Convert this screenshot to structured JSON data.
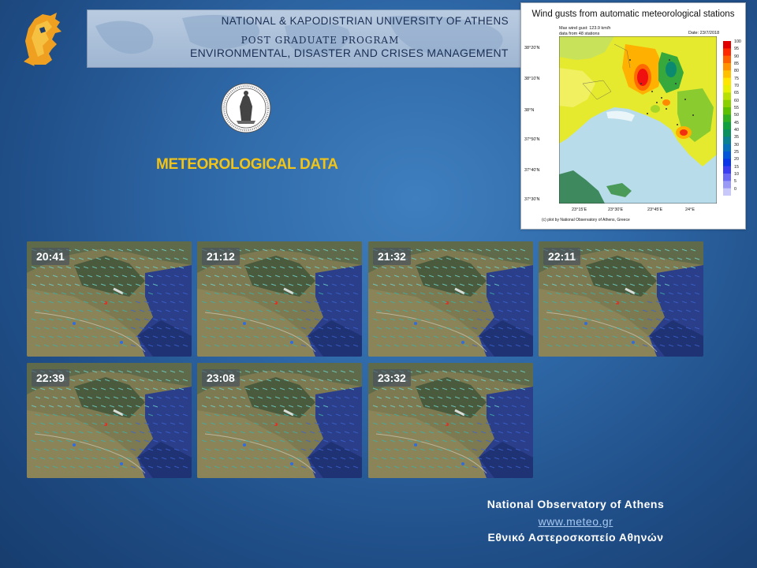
{
  "header": {
    "university": "NATIONAL & KAPODISTRIAN UNIVERSITY OF ATHENS",
    "program": "POST GRADUATE PROGRAM",
    "specialization": "ENVIRONMENTAL, DISASTER AND CRISES MANAGEMENT"
  },
  "section_title": "METEOROLOGICAL DATA",
  "map": {
    "title": "Wind gusts from automatic meteorological stations",
    "info_line1": "Max wind gust: 123.9 km/h",
    "info_line2": "data from 48 stations",
    "date": "Date: 23/7/2018",
    "credit": "(c) plot by National Observatory of Athens, Greece",
    "lat_labels": [
      "38°20'N",
      "38°10'N",
      "38°N",
      "37°50'N",
      "37°40'N",
      "37°30'N"
    ],
    "lon_labels": [
      "23°15'E",
      "23°30'E",
      "23°45'E",
      "24°E"
    ],
    "colorbar_labels": [
      "100",
      "95",
      "90",
      "85",
      "80",
      "75",
      "70",
      "65",
      "60",
      "55",
      "50",
      "45",
      "40",
      "35",
      "30",
      "25",
      "20",
      "15",
      "10",
      "5",
      "0"
    ],
    "colorbar_colors": [
      "#e00000",
      "#ff2a00",
      "#ff6000",
      "#ff9400",
      "#ffc000",
      "#ffe600",
      "#e6f000",
      "#b8e000",
      "#8ad000",
      "#5cbf00",
      "#2eae20",
      "#10a040",
      "#0c9060",
      "#0a8090",
      "#0870b8",
      "#0656d8",
      "#0a36e8",
      "#3a3ef0",
      "#6a6af4",
      "#9a9af6",
      "#c8c8fa"
    ]
  },
  "timestamps": [
    "20:41",
    "21:12",
    "21:32",
    "22:11",
    "22:39",
    "23:08",
    "23:32"
  ],
  "footer": {
    "org_en": "National Observatory of Athens",
    "website": "www.meteo.gr",
    "org_gr": "Εθνικό Αστεροσκοπείο Αθηνών"
  }
}
